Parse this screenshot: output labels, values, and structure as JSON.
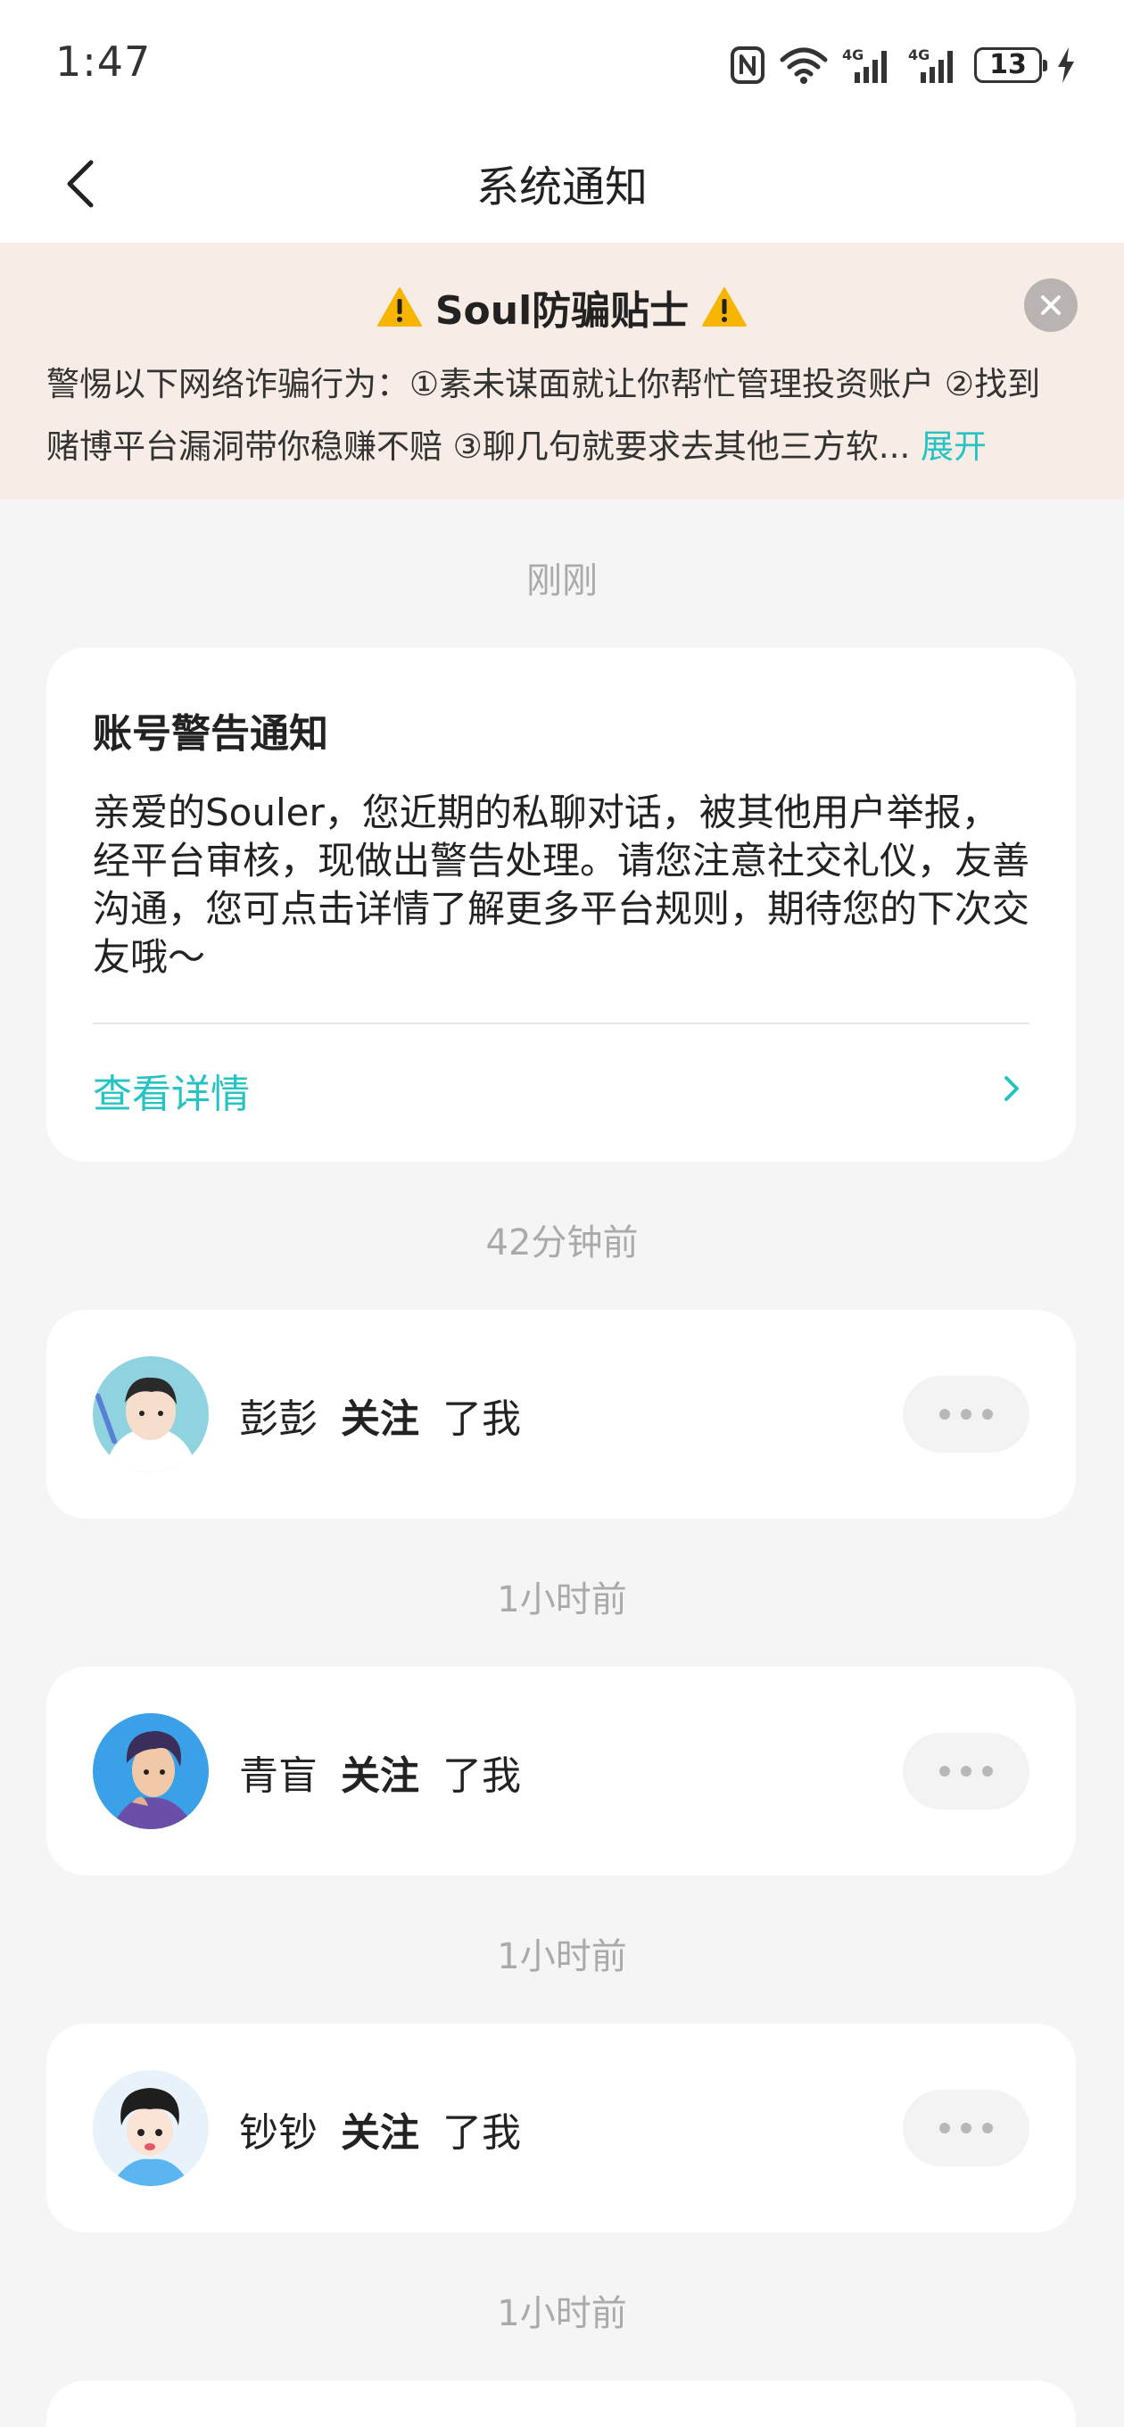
{
  "status_bar": {
    "time": "1:47",
    "battery": "13",
    "icons": [
      "nfc-icon",
      "wifi-icon",
      "signal-4g-icon",
      "signal-4g-icon",
      "battery-icon",
      "charging-icon"
    ]
  },
  "nav": {
    "title": "系统通知",
    "back_icon": "chevron-left-icon"
  },
  "banner": {
    "title": "Soul防骗贴士",
    "text": "警惕以下网络诈骗行为：①素未谋面就让你帮忙管理投资账户 ②找到赌博平台漏洞带你稳赚不赔 ③聊几句就要求去其他三方软...",
    "expand_label": "展开",
    "icons": [
      "warning-icon",
      "close-icon"
    ]
  },
  "notifications": [
    {
      "time": "刚刚",
      "type": "warning",
      "title": "账号警告通知",
      "body": "亲爱的Souler，您近期的私聊对话，被其他用户举报，经平台审核，现做出警告处理。请您注意社交礼仪，友善沟通，您可点击详情了解更多平台规则，期待您的下次交友哦～",
      "link_label": "查看详情"
    },
    {
      "time": "42分钟前",
      "type": "follow",
      "user": "彭彭",
      "action": "关注",
      "suffix": "了我"
    },
    {
      "time": "1小时前",
      "type": "follow",
      "user": "青盲",
      "action": "关注",
      "suffix": "了我"
    },
    {
      "time": "1小时前",
      "type": "follow",
      "user": "钞钞",
      "action": "关注",
      "suffix": "了我"
    },
    {
      "time": "1小时前",
      "type": "partial"
    }
  ],
  "colors": {
    "accent": "#27c2c2",
    "banner_bg": "#f8ede6",
    "page_bg": "#f5f5f5"
  }
}
